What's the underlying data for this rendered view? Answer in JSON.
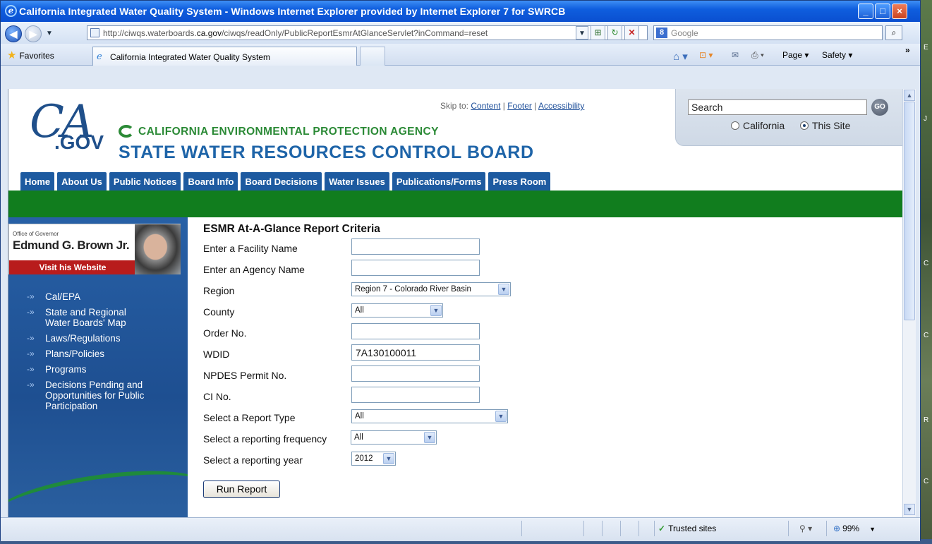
{
  "window": {
    "title": "California Integrated Water Quality System - Windows Internet Explorer provided by Internet Explorer 7 for SWRCB",
    "controls": [
      "_",
      "□",
      "×"
    ]
  },
  "address_bar": {
    "url_prefix": "http://ciwqs.waterboards.",
    "url_domain": "ca.gov",
    "url_suffix": "/ciwqs/readOnly/PublicReportEsmrAtGlanceServlet?inCommand=reset",
    "search_placeholder": "Google"
  },
  "favorites_bar": {
    "favorites_label": "Favorites",
    "tab_title": "California Integrated Water Quality System",
    "commands": [
      "Page ▾",
      "Safety ▾"
    ]
  },
  "site_header": {
    "logo": "CA.GOV",
    "agency": "CALIFORNIA ENVIRONMENTAL PROTECTION AGENCY",
    "board": "STATE WATER RESOURCES CONTROL BOARD",
    "skip_label": "Skip to:",
    "skip_links": [
      "Content",
      "Footer",
      "Accessibility"
    ],
    "search_value": "Search",
    "search_button": "GO",
    "search_scope": [
      "California",
      "This Site"
    ],
    "search_scope_selected": "This Site"
  },
  "top_nav": [
    "Home",
    "About Us",
    "Public Notices",
    "Board Info",
    "Board Decisions",
    "Water Issues",
    "Publications/Forms",
    "Press Room"
  ],
  "governor_banner": {
    "office": "Office of Governor",
    "name": "Edmund G. Brown Jr.",
    "link": "Visit his Website"
  },
  "left_nav": [
    "Cal/EPA",
    "State and Regional Water Boards' Map",
    "Laws/Regulations",
    "Plans/Policies",
    "Programs",
    "Decisions Pending and Opportunities for Public Participation"
  ],
  "form": {
    "title": "ESMR At-A-Glance Report Criteria",
    "facility_label": "Enter a Facility Name",
    "facility_value": "",
    "agency_label": "Enter an Agency Name",
    "agency_value": "",
    "region_label": "Region",
    "region_value": "Region 7 - Colorado River Basin",
    "county_label": "County",
    "county_value": "All",
    "order_label": "Order No.",
    "order_value": "",
    "wdid_label": "WDID",
    "wdid_value": "7A130100011",
    "npdes_label": "NPDES Permit No.",
    "npdes_value": "",
    "ci_label": "CI No.",
    "ci_value": "",
    "report_type_label": "Select a Report Type",
    "report_type_value": "All",
    "frequency_label": "Select a reporting frequency",
    "frequency_value": "All",
    "year_label": "Select a reporting year",
    "year_value": "2012",
    "run_button": "Run Report"
  },
  "status_bar": {
    "zone": "Trusted sites",
    "zoom": "99%"
  },
  "desktop_edge": [
    "E",
    "J",
    "C",
    "C",
    "R",
    "C"
  ]
}
